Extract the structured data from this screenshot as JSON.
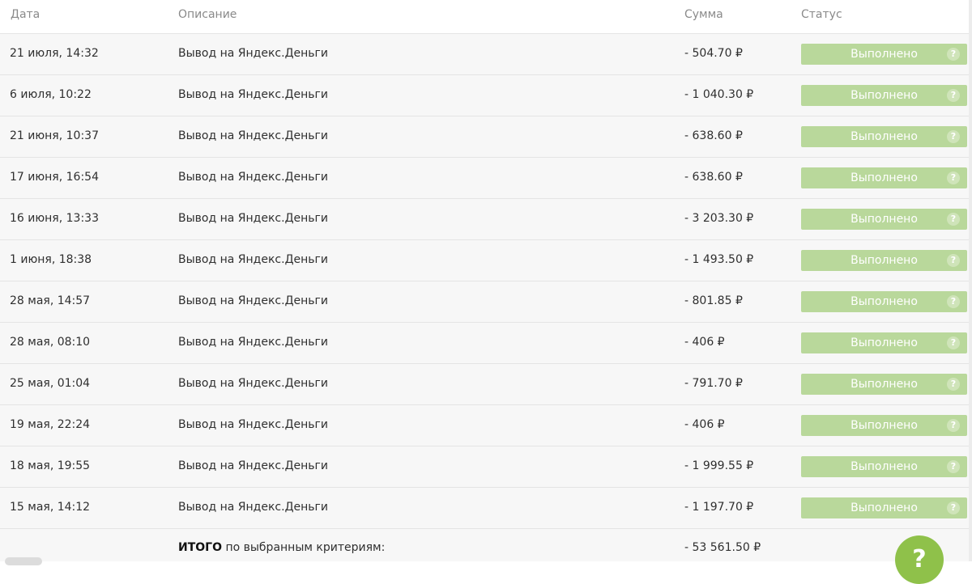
{
  "header": {
    "date": "Дата",
    "description": "Описание",
    "amount": "Сумма",
    "status": "Статус"
  },
  "rows": [
    {
      "date": "21 июля, 14:32",
      "description": "Вывод на Яндекс.Деньги",
      "amount": "- 504.70 ₽",
      "status": "Выполнено"
    },
    {
      "date": "6 июля, 10:22",
      "description": "Вывод на Яндекс.Деньги",
      "amount": "- 1 040.30 ₽",
      "status": "Выполнено"
    },
    {
      "date": "21 июня, 10:37",
      "description": "Вывод на Яндекс.Деньги",
      "amount": "- 638.60 ₽",
      "status": "Выполнено"
    },
    {
      "date": "17 июня, 16:54",
      "description": "Вывод на Яндекс.Деньги",
      "amount": "- 638.60 ₽",
      "status": "Выполнено"
    },
    {
      "date": "16 июня, 13:33",
      "description": "Вывод на Яндекс.Деньги",
      "amount": "- 3 203.30 ₽",
      "status": "Выполнено"
    },
    {
      "date": "1 июня, 18:38",
      "description": "Вывод на Яндекс.Деньги",
      "amount": "- 1 493.50 ₽",
      "status": "Выполнено"
    },
    {
      "date": "28 мая, 14:57",
      "description": "Вывод на Яндекс.Деньги",
      "amount": "- 801.85 ₽",
      "status": "Выполнено"
    },
    {
      "date": "28 мая, 08:10",
      "description": "Вывод на Яндекс.Деньги",
      "amount": "- 406 ₽",
      "status": "Выполнено"
    },
    {
      "date": "25 мая, 01:04",
      "description": "Вывод на Яндекс.Деньги",
      "amount": "- 791.70 ₽",
      "status": "Выполнено"
    },
    {
      "date": "19 мая, 22:24",
      "description": "Вывод на Яндекс.Деньги",
      "amount": "- 406 ₽",
      "status": "Выполнено"
    },
    {
      "date": "18 мая, 19:55",
      "description": "Вывод на Яндекс.Деньги",
      "amount": "- 1 999.55 ₽",
      "status": "Выполнено"
    },
    {
      "date": "15 мая, 14:12",
      "description": "Вывод на Яндекс.Деньги",
      "amount": "- 1 197.70 ₽",
      "status": "Выполнено"
    }
  ],
  "status_help_glyph": "?",
  "total": {
    "bold": "ИТОГО",
    "label": " по выбранным критериям:",
    "amount": "- 53 561.50 ₽"
  },
  "help_button": {
    "glyph": "?"
  },
  "colors": {
    "status_bg": "#b9d89b",
    "help_bg": "#8fc14a"
  }
}
